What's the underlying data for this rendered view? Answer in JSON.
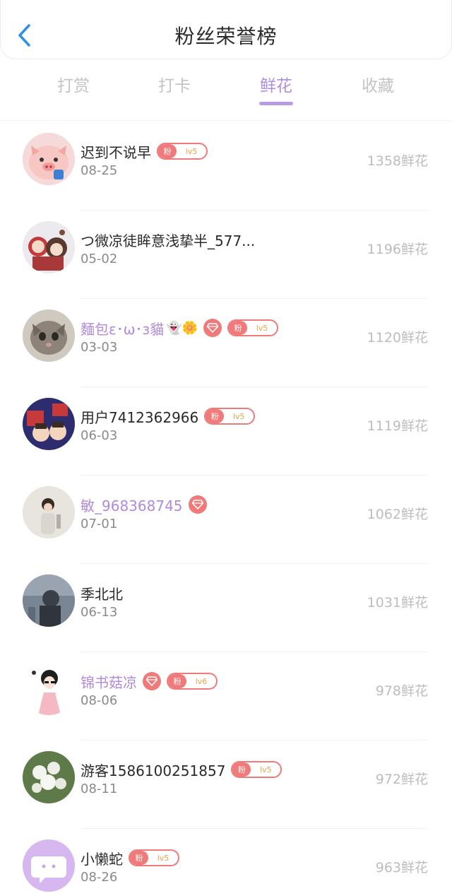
{
  "header": {
    "title": "粉丝荣誉榜"
  },
  "tabs": [
    {
      "label": "打赏",
      "active": false
    },
    {
      "label": "打卡",
      "active": false
    },
    {
      "label": "鲜花",
      "active": true
    },
    {
      "label": "收藏",
      "active": false
    }
  ],
  "fans": [
    {
      "name": "迟到不说早",
      "date": "08-25",
      "score": "1358鲜花",
      "vip": false,
      "diamond": false,
      "badge": {
        "tag": "粉",
        "level": "lv5"
      },
      "emoji": ""
    },
    {
      "name": "つ微凉徒眸意浅挚半_577...",
      "date": "05-02",
      "score": "1196鲜花",
      "vip": false,
      "diamond": false,
      "badge": null,
      "emoji": ""
    },
    {
      "name": "麵包ε･ω･з貓",
      "date": "03-03",
      "score": "1120鲜花",
      "vip": true,
      "diamond": true,
      "badge": {
        "tag": "粉",
        "level": "lv5"
      },
      "emoji": "👻🌼"
    },
    {
      "name": "用户7412362966",
      "date": "06-03",
      "score": "1119鲜花",
      "vip": false,
      "diamond": false,
      "badge": {
        "tag": "粉",
        "level": "lv5"
      },
      "emoji": ""
    },
    {
      "name": "敏_968368745",
      "date": "07-01",
      "score": "1062鲜花",
      "vip": true,
      "diamond": true,
      "badge": null,
      "emoji": ""
    },
    {
      "name": "季北北",
      "date": "06-13",
      "score": "1031鲜花",
      "vip": false,
      "diamond": false,
      "badge": null,
      "emoji": ""
    },
    {
      "name": "锦书菇凉",
      "date": "08-06",
      "score": "978鲜花",
      "vip": true,
      "diamond": true,
      "badge": {
        "tag": "粉",
        "level": "lv6"
      },
      "emoji": ""
    },
    {
      "name": "游客1586100251857",
      "date": "08-11",
      "score": "972鲜花",
      "vip": false,
      "diamond": false,
      "badge": {
        "tag": "粉",
        "level": "lv5"
      },
      "emoji": ""
    },
    {
      "name": "小懒蛇",
      "date": "08-26",
      "score": "963鲜花",
      "vip": false,
      "diamond": false,
      "badge": {
        "tag": "粉",
        "level": "lv5"
      },
      "emoji": ""
    }
  ],
  "colors": {
    "accent": "#b08de0",
    "badge": "#f07a7a",
    "back_arrow": "#2f8fe8",
    "muted": "#bdbdbd"
  }
}
